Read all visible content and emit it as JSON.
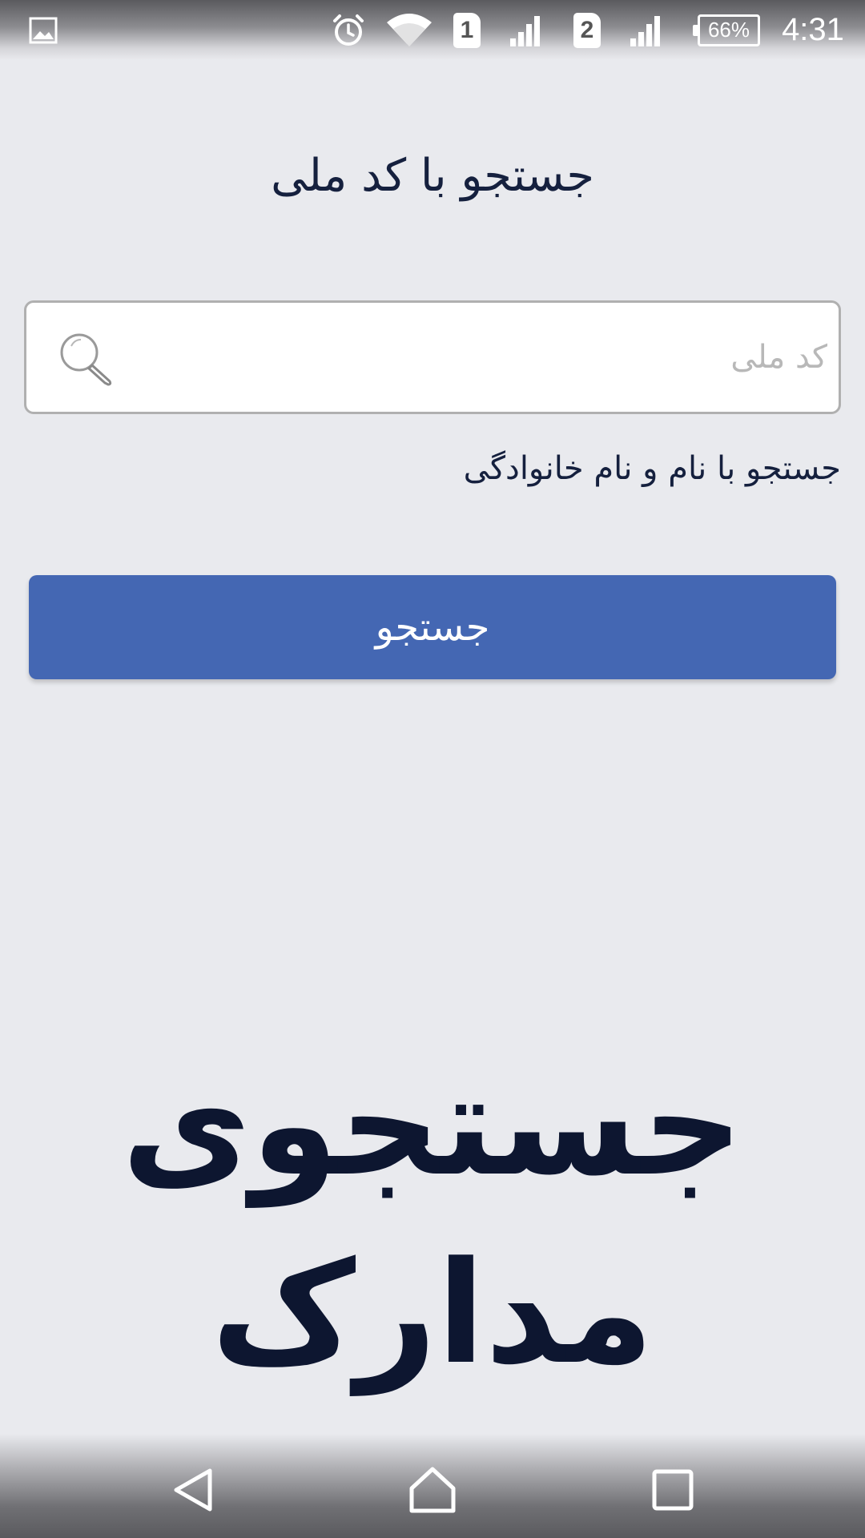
{
  "status_bar": {
    "time": "4:31",
    "battery_text": "66%",
    "sim1_label": "1",
    "sim2_label": "2",
    "icons": [
      "gallery-icon",
      "alarm-icon",
      "wifi-icon",
      "sim1-icon",
      "signal1-icon",
      "sim2-icon",
      "signal2-icon",
      "battery-icon"
    ]
  },
  "main": {
    "title": "جستجو با کد ملی",
    "search": {
      "value": "",
      "placeholder": "کد ملی"
    },
    "alt_search_link": "جستجو با نام و نام خانوادگی",
    "search_button_label": "جستجو"
  },
  "logo": {
    "line1": "جستجوی",
    "line2": "مدارک"
  },
  "nav_bar": {
    "icons": [
      "back-icon",
      "home-icon",
      "recents-icon"
    ]
  },
  "colors": {
    "background": "#e9eaee",
    "accent": "#4467b3",
    "text_dark": "#15203e"
  }
}
